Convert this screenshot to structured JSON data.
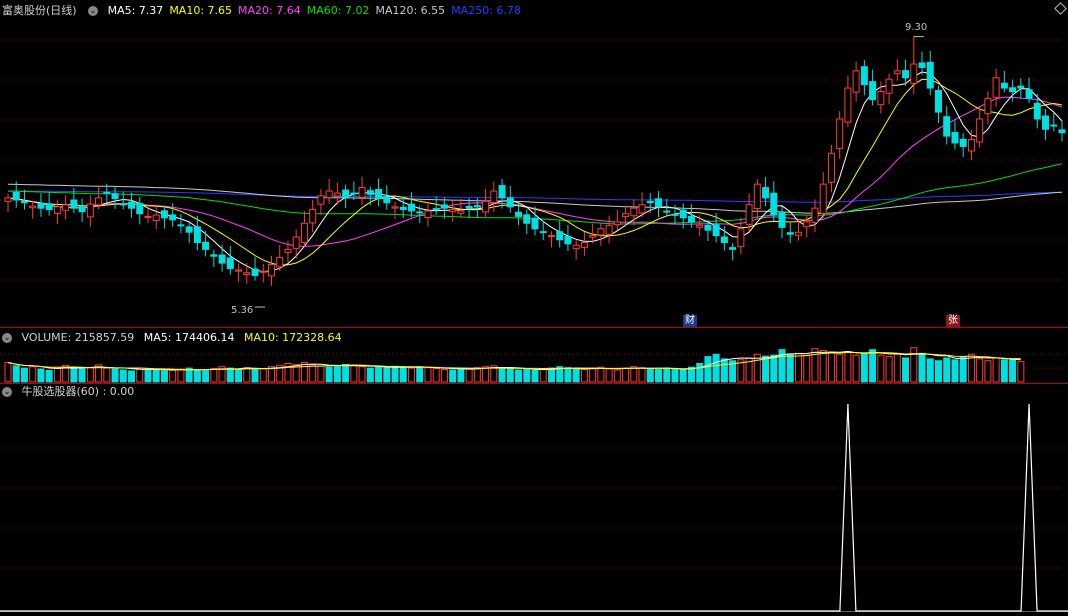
{
  "header": {
    "stock_name": "富奥股份(日线)",
    "ma": [
      {
        "label": "MA5: 7.37",
        "color": "#ffffff"
      },
      {
        "label": "MA10: 7.65",
        "color": "#ffff00"
      },
      {
        "label": "MA20: 7.64",
        "color": "#ff40ff"
      },
      {
        "label": "MA60: 7.02",
        "color": "#00e000"
      },
      {
        "label": "MA120: 6.55",
        "color": "#c8c8c8"
      },
      {
        "label": "MA250: 6.78",
        "color": "#2040ff"
      }
    ]
  },
  "volume_header": {
    "volume": "VOLUME: 215857.59",
    "ma5": "MA5: 174406.14",
    "ma10": "MA10: 172328.64"
  },
  "indicator_header": {
    "label": "牛股选股器(60) : 0.00"
  },
  "annotations": {
    "high": "9.30",
    "low": "5.36",
    "marker_cai": "财",
    "marker_zhang": "张"
  },
  "colors": {
    "up": "#ff3c3c",
    "down": "#00e0e0",
    "grid": "#8b0000",
    "separator": "#c00000",
    "ma5": "#ffffff",
    "ma10": "#ffff00",
    "ma20": "#ff40ff",
    "ma60": "#00e000",
    "ma120": "#c8c8c8",
    "ma250": "#2040ff"
  },
  "chart_data": {
    "type": "candlestick",
    "high_label": 9.3,
    "low_label": 5.36,
    "price_range": [
      5.2,
      9.6
    ],
    "closes": [
      6.95,
      6.92,
      6.88,
      6.83,
      6.8,
      6.78,
      6.82,
      6.85,
      6.8,
      6.75,
      6.86,
      6.95,
      7.02,
      6.94,
      6.86,
      6.8,
      6.72,
      6.68,
      6.7,
      6.66,
      6.63,
      6.55,
      6.45,
      6.3,
      6.2,
      6.1,
      6.0,
      5.92,
      5.9,
      5.86,
      5.82,
      5.88,
      5.98,
      6.08,
      6.2,
      6.38,
      6.58,
      6.78,
      6.98,
      7.05,
      7.02,
      6.96,
      7.02,
      7.1,
      7.0,
      6.94,
      6.88,
      6.82,
      6.78,
      6.76,
      6.74,
      6.76,
      6.78,
      6.8,
      6.78,
      6.76,
      6.8,
      6.82,
      6.9,
      7.05,
      6.95,
      6.82,
      6.68,
      6.58,
      6.5,
      6.45,
      6.4,
      6.34,
      6.28,
      6.26,
      6.3,
      6.4,
      6.5,
      6.55,
      6.6,
      6.72,
      6.8,
      6.85,
      6.88,
      6.82,
      6.75,
      6.7,
      6.66,
      6.6,
      6.55,
      6.48,
      6.4,
      6.3,
      6.2,
      6.5,
      6.85,
      7.15,
      6.95,
      6.7,
      6.52,
      6.42,
      6.45,
      6.6,
      6.8,
      7.15,
      7.6,
      8.1,
      8.55,
      8.8,
      8.6,
      8.38,
      8.5,
      8.68,
      8.8,
      8.7,
      8.9,
      8.85,
      8.55,
      8.2,
      7.85,
      7.75,
      7.7,
      7.8,
      8.1,
      8.4,
      8.7,
      8.55,
      8.5,
      8.55,
      8.4,
      8.1,
      7.95,
      8.0,
      7.9
    ]
  },
  "volume_data": {
    "values": [
      42,
      35,
      30,
      33,
      28,
      25,
      30,
      36,
      32,
      28,
      31,
      37,
      30,
      28,
      26,
      24,
      30,
      28,
      26,
      24,
      25,
      28,
      30,
      26,
      24,
      29,
      33,
      30,
      28,
      31,
      27,
      29,
      33,
      36,
      40,
      38,
      42,
      37,
      34,
      32,
      35,
      38,
      36,
      33,
      30,
      32,
      31,
      34,
      32,
      30,
      33,
      31,
      29,
      27,
      26,
      30,
      28,
      31,
      33,
      35,
      30,
      28,
      26,
      27,
      25,
      28,
      30,
      33,
      31,
      29,
      27,
      30,
      32,
      28,
      26,
      30,
      33,
      31,
      29,
      27,
      30,
      28,
      26,
      32,
      40,
      55,
      60,
      50,
      46,
      48,
      52,
      60,
      56,
      58,
      70,
      60,
      62,
      58,
      72,
      68,
      64,
      60,
      66,
      58,
      62,
      70,
      58,
      55,
      60,
      52,
      74,
      62,
      50,
      46,
      52,
      48,
      55,
      60,
      50,
      46,
      52,
      48,
      50,
      44
    ],
    "up": [
      1,
      0,
      0,
      1,
      0,
      0,
      1,
      1,
      0,
      0,
      1,
      1,
      1,
      0,
      0,
      0,
      1,
      0,
      0,
      0,
      1,
      1,
      0,
      0,
      0,
      1,
      1,
      0,
      0,
      1,
      0,
      1,
      1,
      1,
      1,
      1,
      1,
      1,
      1,
      0,
      0,
      0,
      1,
      1,
      0,
      0,
      0,
      0,
      0,
      1,
      0,
      1,
      1,
      1,
      0,
      0,
      1,
      1,
      1,
      1,
      0,
      0,
      0,
      0,
      0,
      1,
      0,
      0,
      0,
      0,
      1,
      1,
      1,
      1,
      1,
      1,
      1,
      1,
      0,
      0,
      0,
      0,
      0,
      0,
      0,
      0,
      0,
      0,
      0,
      1,
      1,
      1,
      0,
      0,
      0,
      0,
      1,
      1,
      1,
      1,
      1,
      1,
      1,
      1,
      0,
      0,
      1,
      1,
      1,
      0,
      1,
      0,
      0,
      0,
      0,
      0,
      0,
      1,
      1,
      1,
      1,
      0,
      0,
      1,
      0,
      0,
      0,
      1,
      0
    ]
  },
  "indicator_data": {
    "spikes_at_index": [
      102,
      124
    ],
    "value": 0.0
  }
}
